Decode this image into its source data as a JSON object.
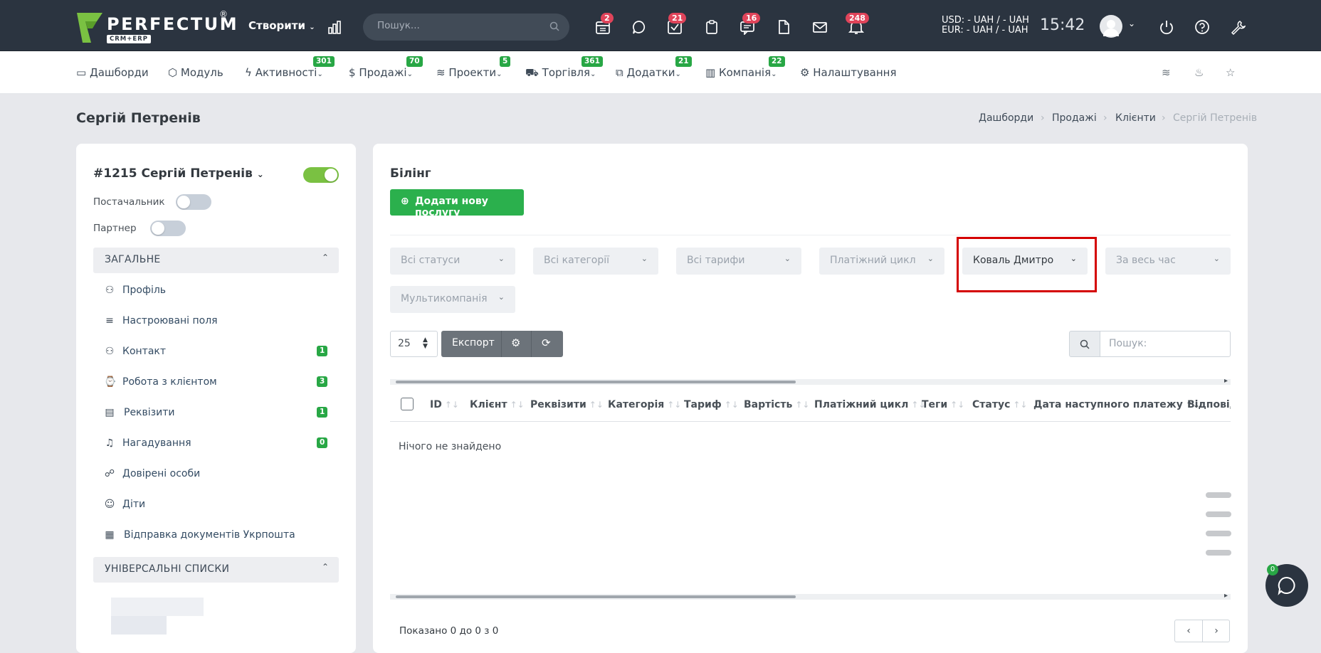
{
  "topbar": {
    "brand": "PERFECTUM",
    "brand_reg": "®",
    "brand_sub": "CRM+ERP",
    "create_label": "Створити",
    "search_placeholder": "Пошук...",
    "badges": {
      "calendar": "2",
      "tasks": "21",
      "chat": "16",
      "notifications": "248"
    },
    "currency_usd": "USD: - UAH / - UAH",
    "currency_eur": "EUR: - UAH / - UAH",
    "time": "15:42"
  },
  "menu": {
    "items": [
      {
        "label": "Дашборди",
        "icon": "monitor-icon"
      },
      {
        "label": "Модуль",
        "icon": "box-icon"
      },
      {
        "label": "Активності",
        "icon": "bolt-icon",
        "badge": "301"
      },
      {
        "label": "Продажі",
        "icon": "dollar-icon",
        "badge": "70"
      },
      {
        "label": "Проекти",
        "icon": "layers-icon",
        "badge": "5"
      },
      {
        "label": "Торгівля",
        "icon": "cart-icon",
        "badge": "361"
      },
      {
        "label": "Додатки",
        "icon": "copy-icon",
        "badge": "21"
      },
      {
        "label": "Компанія",
        "icon": "building-icon",
        "badge": "22"
      },
      {
        "label": "Налаштування",
        "icon": "gear-icon"
      }
    ]
  },
  "page": {
    "title": "Сергій Петренів"
  },
  "breadcrumb": [
    "Дашборди",
    "Продажі",
    "Клієнти",
    "Сергій Петренів"
  ],
  "client": {
    "name": "#1215 Сергій Петренів",
    "supplier_label": "Постачальник",
    "partner_label": "Партнер"
  },
  "sidebar": {
    "general_title": "ЗАГАЛЬНЕ",
    "items": [
      {
        "label": "Профіль",
        "icon": "user-icon"
      },
      {
        "label": "Настроювані поля",
        "icon": "lines-icon"
      },
      {
        "label": "Контакт",
        "icon": "users-icon",
        "badge": "1"
      },
      {
        "label": "Робота з клієнтом",
        "icon": "watch-icon",
        "badge": "3"
      },
      {
        "label": "Реквізити",
        "icon": "id-card-icon",
        "badge": "1"
      },
      {
        "label": "Нагадування",
        "icon": "bell-icon",
        "badge": "0"
      },
      {
        "label": "Довірені особи",
        "icon": "people-icon"
      },
      {
        "label": "Діти",
        "icon": "child-icon"
      },
      {
        "label": "Відправка документів Укрпошта",
        "icon": "boxes-icon"
      }
    ],
    "universal_title": "УНІВЕРСАЛЬНІ СПИСКИ"
  },
  "billing": {
    "title": "Білінг",
    "add_button": "Додати нову послугу",
    "filters": [
      "Всі статуси",
      "Всі категорії",
      "Всі тарифи",
      "Платіжний цикл",
      "Коваль Дмитро",
      "За весь час",
      "Мультикомпанія"
    ],
    "page_size": "25",
    "export_label": "Експорт",
    "search_placeholder": "Пошук:",
    "columns": [
      "ID",
      "Клієнт",
      "Реквізити",
      "Категорія",
      "Тариф",
      "Вартість",
      "Платіжний цикл",
      "Теги",
      "Статус",
      "Дата наступного платежу",
      "Відповіда"
    ],
    "empty_text": "Нічого не знайдено",
    "footer_text": "Показано 0 до 0 з 0"
  },
  "chat": {
    "badge": "0"
  },
  "colors": {
    "accent_green": "#2bb04d",
    "topbar": "#2b3440",
    "badge_red": "#e0445a",
    "highlight": "#d40000"
  }
}
